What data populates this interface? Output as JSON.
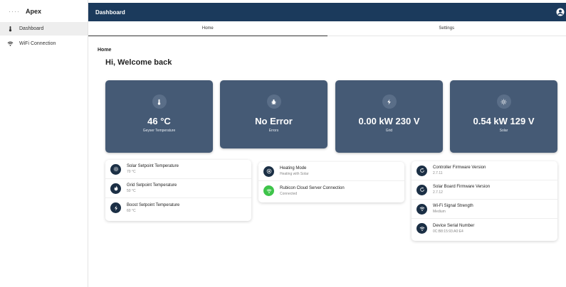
{
  "sidebar": {
    "brand": "Apex",
    "items": [
      {
        "label": "Dashboard",
        "icon": "thermometer-icon",
        "active": true
      },
      {
        "label": "WiFi Connection",
        "icon": "wifi-icon",
        "active": false
      }
    ]
  },
  "topbar": {
    "title": "Dashboard",
    "icon": "account-icon"
  },
  "tabs": [
    {
      "label": "Home",
      "active": true
    },
    {
      "label": "Settings",
      "active": false
    }
  ],
  "breadcrumb": "Home",
  "welcome": "Hi, Welcome back",
  "stats": [
    {
      "value": "46 °C",
      "label": "Geyser Temperature",
      "icon": "thermometer-icon"
    },
    {
      "value": "No Error",
      "label": "Errors",
      "icon": "bug-icon"
    },
    {
      "value": "0.00 kW 230 V",
      "label": "Grid",
      "icon": "bolt-icon"
    },
    {
      "value": "0.54 kW 129 V",
      "label": "Solar",
      "icon": "sun-icon"
    }
  ],
  "setpoints": [
    {
      "title": "Solar Setpoint Temperature",
      "value": "70 °C",
      "icon": "sun-icon"
    },
    {
      "title": "Grid Setpoint Temperature",
      "value": "50 °C",
      "icon": "flame-icon"
    },
    {
      "title": "Boost Setpoint Temperature",
      "value": "60 °C",
      "icon": "bolt-icon"
    }
  ],
  "modes": [
    {
      "title": "Heating Mode",
      "value": "Heating with Solar",
      "icon": "target-icon"
    },
    {
      "title": "Rubicon Cloud Server Connection",
      "value": "Connected",
      "icon": "wifi-icon"
    }
  ],
  "device": [
    {
      "title": "Controller Firmware Version",
      "value": "2.7.11",
      "icon": "refresh-icon"
    },
    {
      "title": "Solar Board Firmware Version",
      "value": "2.7.12",
      "icon": "refresh-icon"
    },
    {
      "title": "Wi-Fi Signal Strength",
      "value": "Medium",
      "icon": "wifi-icon"
    },
    {
      "title": "Device Serial Number",
      "value": "0C:B8:15:93:A0:E4",
      "icon": "wifi-icon"
    }
  ],
  "colors": {
    "topbar": "#1b3a5c",
    "stat_card": "#455a75",
    "row_icon": "#1b2f45",
    "connected": "#3ec44a"
  }
}
